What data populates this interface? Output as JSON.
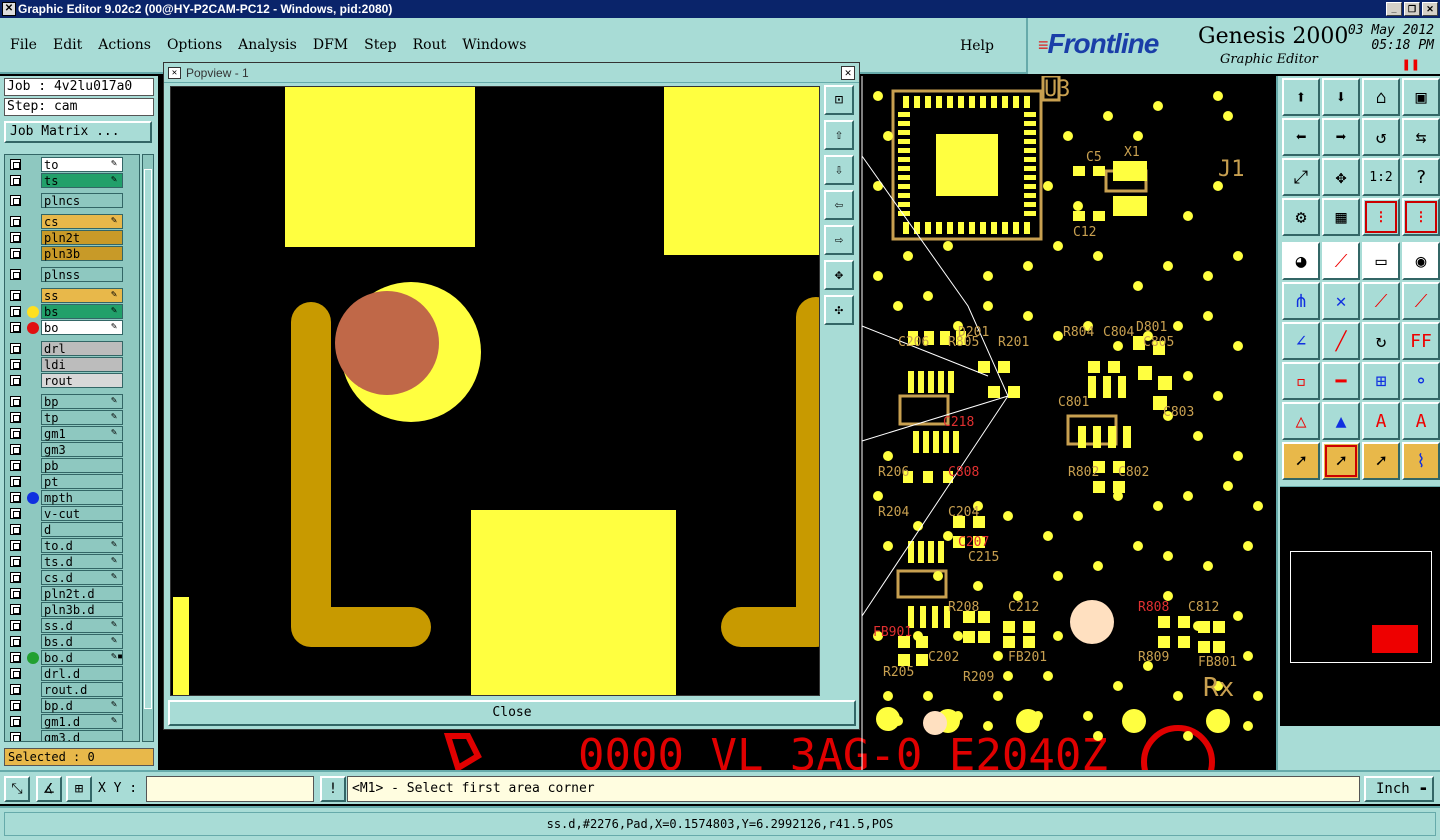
{
  "window": {
    "title": "Graphic Editor 9.02c2 (00@HY-P2CAM-PC12 - Windows, pid:2080)"
  },
  "menu": [
    "File",
    "Edit",
    "Actions",
    "Options",
    "Analysis",
    "DFM",
    "Step",
    "Rout",
    "Windows"
  ],
  "help_label": "Help",
  "brand": {
    "logo": "Frontline",
    "product": "Genesis 2000",
    "subtitle": "Graphic Editor",
    "date": "03 May 2012",
    "time": "05:18 PM"
  },
  "job": {
    "job_label": "Job : 4v2lu017a0",
    "step_label": "Step: cam",
    "matrix_button": "Job Matrix ..."
  },
  "layers": [
    {
      "name": "to",
      "bg": "#ffffff",
      "dot": "",
      "flag": "✎"
    },
    {
      "name": "ts",
      "bg": "#22a06a",
      "dot": "",
      "flag": "✎"
    },
    {
      "name": "plncs",
      "bg": "#8ec8c0",
      "dot": "",
      "flag": ""
    },
    {
      "name": "cs",
      "bg": "#e8b84a",
      "dot": "",
      "flag": "✎"
    },
    {
      "name": "pln2t",
      "bg": "#c89a28",
      "dot": "",
      "flag": ""
    },
    {
      "name": "pln3b",
      "bg": "#c89a28",
      "dot": "",
      "flag": ""
    },
    {
      "name": "plnss",
      "bg": "#8ec8c0",
      "dot": "",
      "flag": ""
    },
    {
      "name": "ss",
      "bg": "#e8b84a",
      "dot": "",
      "flag": "✎"
    },
    {
      "name": "bs",
      "bg": "#22a06a",
      "dot": "#ffe020",
      "flag": "✎"
    },
    {
      "name": "bo",
      "bg": "#ffffff",
      "dot": "#e01010",
      "flag": "✎"
    },
    {
      "name": "drl",
      "bg": "#bcbcbc",
      "dot": "",
      "flag": ""
    },
    {
      "name": "ldi",
      "bg": "#bcbcbc",
      "dot": "",
      "flag": ""
    },
    {
      "name": "rout",
      "bg": "#d8d8d8",
      "dot": "",
      "flag": ""
    },
    {
      "name": "bp",
      "bg": "#8ec8c0",
      "dot": "",
      "flag": "✎"
    },
    {
      "name": "tp",
      "bg": "#8ec8c0",
      "dot": "",
      "flag": "✎"
    },
    {
      "name": "gm1",
      "bg": "#8ec8c0",
      "dot": "",
      "flag": "✎"
    },
    {
      "name": "gm3",
      "bg": "#8ec8c0",
      "dot": "",
      "flag": ""
    },
    {
      "name": "pb",
      "bg": "#8ec8c0",
      "dot": "",
      "flag": ""
    },
    {
      "name": "pt",
      "bg": "#8ec8c0",
      "dot": "",
      "flag": ""
    },
    {
      "name": "mpth",
      "bg": "#8ec8c0",
      "dot": "#1030e0",
      "flag": ""
    },
    {
      "name": "v-cut",
      "bg": "#8ec8c0",
      "dot": "",
      "flag": ""
    },
    {
      "name": "d",
      "bg": "#8ec8c0",
      "dot": "",
      "flag": ""
    },
    {
      "name": "to.d",
      "bg": "#8ec8c0",
      "dot": "",
      "flag": "✎"
    },
    {
      "name": "ts.d",
      "bg": "#8ec8c0",
      "dot": "",
      "flag": "✎"
    },
    {
      "name": "cs.d",
      "bg": "#8ec8c0",
      "dot": "",
      "flag": "✎"
    },
    {
      "name": "pln2t.d",
      "bg": "#8ec8c0",
      "dot": "",
      "flag": ""
    },
    {
      "name": "pln3b.d",
      "bg": "#8ec8c0",
      "dot": "",
      "flag": ""
    },
    {
      "name": "ss.d",
      "bg": "#8ec8c0",
      "dot": "",
      "flag": "✎"
    },
    {
      "name": "bs.d",
      "bg": "#8ec8c0",
      "dot": "",
      "flag": "✎"
    },
    {
      "name": "bo.d",
      "bg": "#8ec8c0",
      "dot": "#22a030",
      "flag": "✎▪"
    },
    {
      "name": "drl.d",
      "bg": "#8ec8c0",
      "dot": "",
      "flag": ""
    },
    {
      "name": "rout.d",
      "bg": "#8ec8c0",
      "dot": "",
      "flag": ""
    },
    {
      "name": "bp.d",
      "bg": "#8ec8c0",
      "dot": "",
      "flag": "✎"
    },
    {
      "name": "gm1.d",
      "bg": "#8ec8c0",
      "dot": "",
      "flag": "✎"
    },
    {
      "name": "gm3.d",
      "bg": "#8ec8c0",
      "dot": "",
      "flag": ""
    }
  ],
  "selected_label": "Selected : 0",
  "popview": {
    "title": "Popview - 1",
    "close_label": "Close"
  },
  "board_labels": [
    "U3",
    "C5",
    "X1",
    "J1",
    "C12",
    "D801",
    "C804",
    "R804",
    "C808",
    "C812",
    "R808",
    "R809",
    "FB801",
    "Rx",
    "R802",
    "C802",
    "C803",
    "C801",
    "C805",
    "R805",
    "C218",
    "C215",
    "R208",
    "C212",
    "C202",
    "R209",
    "FB201",
    "R205",
    "FB901",
    "R204",
    "R206",
    "C204",
    "C206",
    "R201",
    "D201",
    "C207"
  ],
  "bottom_text": "0000 VL 3AG-0 E2040Z",
  "xy": {
    "label": "X Y :",
    "value": ""
  },
  "prompt": "<M1> - Select first area corner",
  "units": "Inch",
  "status": "ss.d,#2276,Pad,X=0.1574803,Y=6.2992126,r41.5,POS",
  "colors": {
    "panel": "#a8dcd6",
    "pad": "#ffff40",
    "trace": "#c89a00",
    "silk": "#c8a050",
    "drill": "#c06848"
  }
}
